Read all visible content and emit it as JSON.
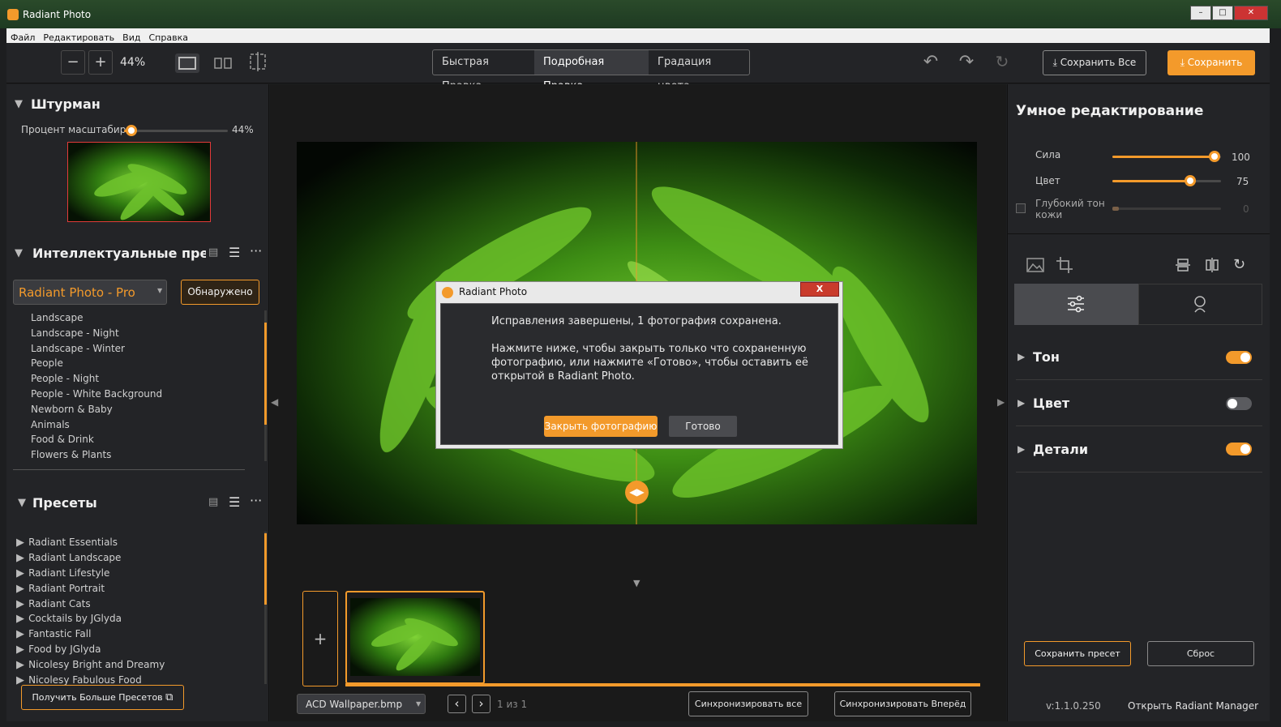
{
  "window": {
    "title": "Radiant Photo",
    "min": "–",
    "max": "□",
    "close": "✕"
  },
  "menu": [
    "Файл",
    "Редактировать",
    "Вид",
    "Справка"
  ],
  "toolbar": {
    "zoom_minus": "−",
    "zoom_plus": "+",
    "zoom_value": "44%",
    "modes": [
      "Быстрая Правка",
      "Подробная Правка",
      "Градация цвета"
    ],
    "active_mode": "Подробная Правка",
    "save_all": "⤓ Сохранить Все",
    "save": "⤓ Сохранить"
  },
  "navigator": {
    "title": "Штурман",
    "zoom_label": "Процент масштабир",
    "zoom_value": "44%",
    "zoom_fraction": 0.07
  },
  "smart_presets": {
    "title": "Интеллектуальные пресе",
    "dropdown_value": "Radiant Photo - Pro",
    "detected_button": "Обнаружено",
    "items": [
      "Landscape",
      "Landscape - Night",
      "Landscape - Winter",
      "People",
      "People - Night",
      "People - White Background",
      "Newborn & Baby",
      "Animals",
      "Food & Drink",
      "Flowers & Plants"
    ],
    "selected": "Food & Drink"
  },
  "presets": {
    "title": "Пресеты",
    "items": [
      "Radiant Essentials",
      "Radiant Landscape",
      "Radiant Lifestyle",
      "Radiant Portrait",
      "Radiant Cats",
      "Cocktails by JGlyda",
      "Fantastic Fall",
      "Food by JGlyda",
      "Nicolesy Bright and Dreamy",
      "Nicolesy Fabulous Food"
    ],
    "highlighted_count": 5,
    "more_button": "Получить Больше Пресетов"
  },
  "dialog": {
    "title": "Radiant Photo",
    "close": "X",
    "line1": "Исправления завершены, 1 фотография сохранена.",
    "line2a": "Нажмите ниже, чтобы закрыть только что сохраненную",
    "line2b": "фотографию, или нажмите «Готово», чтобы оставить её",
    "line2c": "открытой в Radiant Photo.",
    "close_photo_button": "Закрыть фотографию",
    "done_button": "Готово"
  },
  "filmstrip": {
    "add": "+",
    "file_select": "ACD Wallpaper.bmp",
    "prev": "‹",
    "next": "›",
    "page_info": "1 из 1",
    "sync_all": "Синхронизировать все",
    "sync_forward": "Синхронизировать Вперёд"
  },
  "smart_edit": {
    "title": "Умное редактирование",
    "strength_label": "Сила",
    "strength_value": "100",
    "strength": 1.0,
    "color_label": "Цвет",
    "color_value": "75",
    "color": 0.75,
    "skin_label_a": "Глубокий тон",
    "skin_label_b": "кожи",
    "skin_value": "0",
    "skin": 0.0
  },
  "adjustments": [
    {
      "label": "Тон",
      "on": true
    },
    {
      "label": "Цвет",
      "on": false
    },
    {
      "label": "Детали",
      "on": true
    }
  ],
  "right_footer": {
    "save_preset": "Сохранить пресет",
    "reset": "Сброс",
    "version": "v:1.1.0.250",
    "open_manager": "Открыть Radiant Manager"
  },
  "colors": {
    "accent": "#f39a2b",
    "panel": "#232427"
  }
}
